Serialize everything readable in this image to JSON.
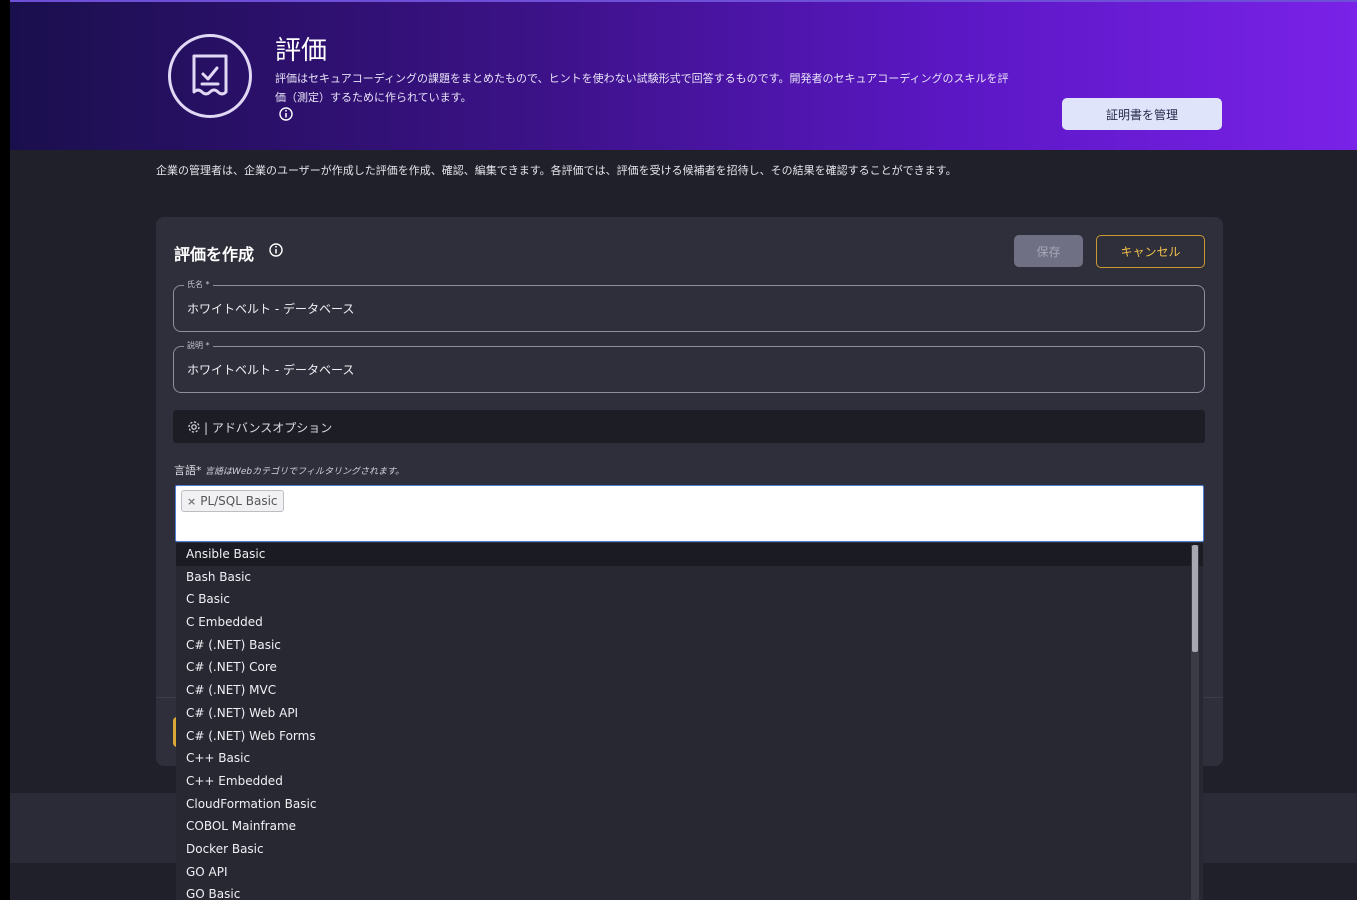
{
  "header": {
    "title": "評価",
    "description": "評価はセキュアコーディングの課題をまとめたもので、ヒントを使わない試験形式で回答するものです。開発者のセキュアコーディングのスキルを評価（測定）するために作られています。",
    "manage_certificates_label": "証明書を管理"
  },
  "admin_note": "企業の管理者は、企業のユーザーが作成した評価を作成、確認、編集できます。各評価では、評価を受ける候補者を招待し、その結果を確認することができます。",
  "form": {
    "title": "評価を作成",
    "save_label": "保存",
    "cancel_label": "キャンセル",
    "name_label": "氏名 *",
    "name_value": "ホワイトベルト - データベース",
    "description_label": "説明 *",
    "description_value": "ホワイトベルト - データベース",
    "advanced_options_label": "アドバンスオプション",
    "language_label": "言語*",
    "language_hint": "言語はWebカテゴリでフィルタリングされます。",
    "selected_languages": [
      "PL/SQL Basic"
    ]
  },
  "language_dropdown": {
    "highlighted_index": 0,
    "options": [
      "Ansible Basic",
      "Bash Basic",
      "C Basic",
      "C Embedded",
      "C# (.NET) Basic",
      "C# (.NET) Core",
      "C# (.NET) MVC",
      "C# (.NET) Web API",
      "C# (.NET) Web Forms",
      "C++ Basic",
      "C++ Embedded",
      "CloudFormation Basic",
      "COBOL Mainframe",
      "Docker Basic",
      "GO API",
      "GO Basic"
    ]
  },
  "colors": {
    "hero_gradient_start": "#1a0f4d",
    "hero_gradient_end": "#7a22e8",
    "cancel_accent": "#f2c04a",
    "select_focus_border": "#4f7fd9"
  }
}
